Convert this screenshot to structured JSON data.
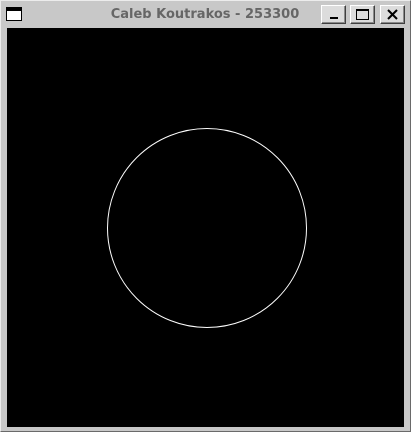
{
  "window": {
    "title": "Caleb Koutrakos - 253300",
    "controls": {
      "system_menu_icon": "window-menu-icon",
      "minimize_icon": "minimize-icon",
      "maximize_icon": "maximize-icon",
      "close_icon": "close-icon"
    }
  },
  "canvas": {
    "background": "#000000",
    "circle": {
      "stroke": "#ffffff",
      "fill": "none"
    }
  }
}
